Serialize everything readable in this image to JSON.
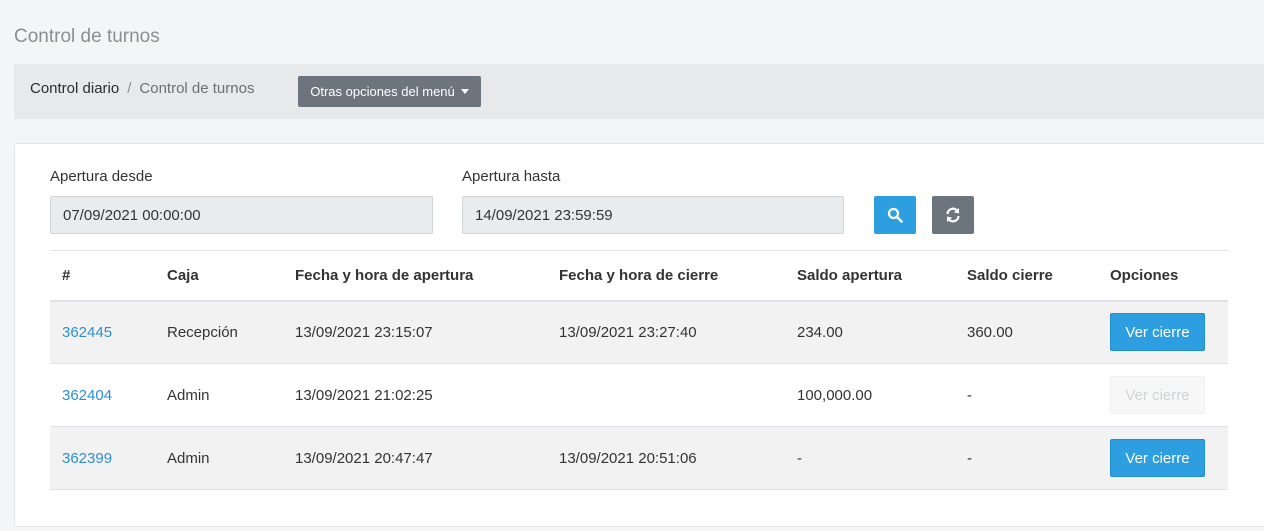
{
  "page": {
    "title": "Control de turnos"
  },
  "breadcrumb": {
    "items": [
      "Control diario",
      "Control de turnos"
    ],
    "separator": "/"
  },
  "menu_button": {
    "label": "Otras opciones del menú"
  },
  "filters": {
    "from_label": "Apertura desde",
    "from_value": "07/09/2021 00:00:00",
    "to_label": "Apertura hasta",
    "to_value": "14/09/2021 23:59:59",
    "search_icon": "search-icon",
    "refresh_icon": "refresh-icon"
  },
  "table": {
    "headers": [
      "#",
      "Caja",
      "Fecha y hora de apertura",
      "Fecha y hora de cierre",
      "Saldo apertura",
      "Saldo cierre",
      "Opciones"
    ],
    "rows": [
      {
        "id": "362445",
        "caja": "Recepción",
        "apertura": "13/09/2021 23:15:07",
        "cierre": "13/09/2021 23:27:40",
        "saldo_apertura": "234.00",
        "saldo_cierre": "360.00",
        "action": "Ver cierre",
        "action_enabled": true
      },
      {
        "id": "362404",
        "caja": "Admin",
        "apertura": "13/09/2021 21:02:25",
        "cierre": "",
        "saldo_apertura": "100,000.00",
        "saldo_cierre": "-",
        "action": "Ver cierre",
        "action_enabled": false
      },
      {
        "id": "362399",
        "caja": "Admin",
        "apertura": "13/09/2021 20:47:47",
        "cierre": "13/09/2021 20:51:06",
        "saldo_apertura": "-",
        "saldo_cierre": "-",
        "action": "Ver cierre",
        "action_enabled": true
      }
    ]
  },
  "colors": {
    "primary": "#2d9ee0",
    "secondary": "#6c757d",
    "link": "#2d8fd0"
  }
}
